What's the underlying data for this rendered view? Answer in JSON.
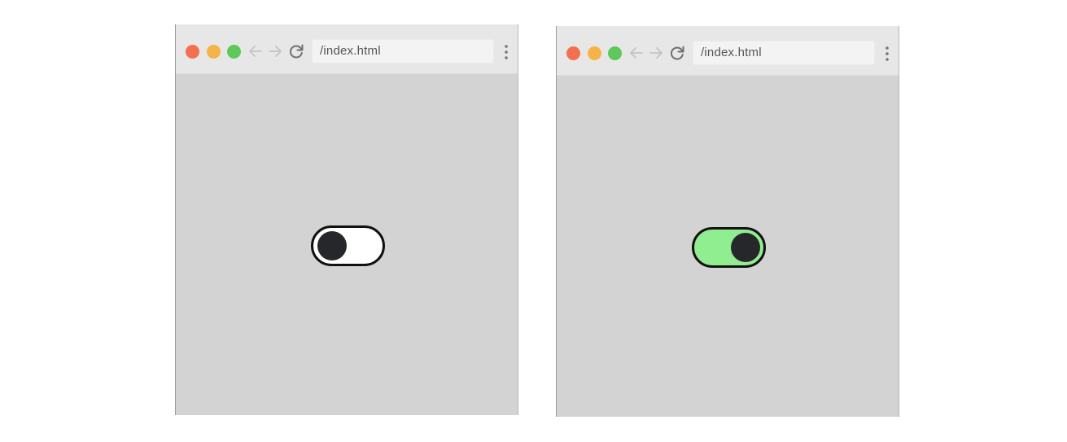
{
  "colors": {
    "traffic_red": "#f2704f",
    "traffic_yellow": "#f6b347",
    "traffic_green": "#5ec95a",
    "toggle_off_track": "#ffffff",
    "toggle_on_track": "#90ee90",
    "knob": "#26272b",
    "viewport_bg": "#d3d3d3"
  },
  "windows": [
    {
      "url": "/index.html",
      "icons": [
        "back-arrow-icon",
        "forward-arrow-icon",
        "reload-icon",
        "kebab-menu-icon"
      ],
      "toggle": {
        "checked": false
      }
    },
    {
      "url": "/index.html",
      "icons": [
        "back-arrow-icon",
        "forward-arrow-icon",
        "reload-icon",
        "kebab-menu-icon"
      ],
      "toggle": {
        "checked": true
      }
    }
  ]
}
